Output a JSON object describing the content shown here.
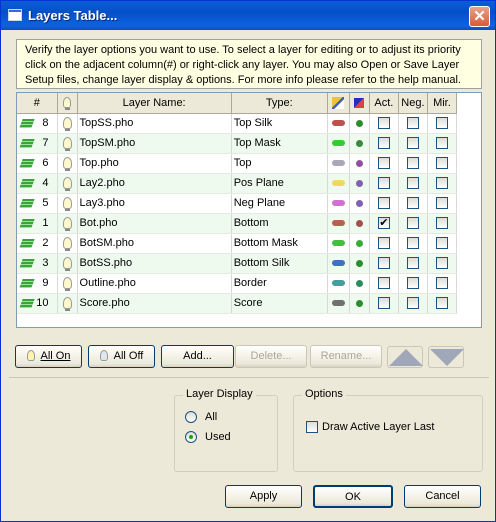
{
  "title": "Layers Table...",
  "info_text": "Verify the layer options you want to use. To select a layer for editing or to adjust its priority click on the adjacent column(#) or right-click any layer.  You may also Open or Save Layer Setup files, change layer display & options.  For more info please refer to the help manual.",
  "table": {
    "headers": {
      "num": "#",
      "name": "Layer Name:",
      "type": "Type:",
      "act": "Act.",
      "neg": "Neg.",
      "mir": "Mir."
    },
    "rows": [
      {
        "num": "8",
        "name": "TopSS.pho",
        "type": "Top Silk",
        "color": "#c0504d",
        "dot": "#2e8b2e",
        "act": false,
        "neg": false,
        "mir": false
      },
      {
        "num": "7",
        "name": "TopSM.pho",
        "type": "Top Mask",
        "color": "#33cc33",
        "dot": "#3a8a3a",
        "act": false,
        "neg": false,
        "mir": false
      },
      {
        "num": "6",
        "name": "Top.pho",
        "type": "Top",
        "color": "#a8a8b8",
        "dot": "#9050a0",
        "act": false,
        "neg": false,
        "mir": false
      },
      {
        "num": "4",
        "name": "Lay2.pho",
        "type": "Pos Plane",
        "color": "#f0d860",
        "dot": "#8060b0",
        "act": false,
        "neg": false,
        "mir": false
      },
      {
        "num": "5",
        "name": "Lay3.pho",
        "type": "Neg Plane",
        "color": "#d070d0",
        "dot": "#8060b0",
        "act": false,
        "neg": false,
        "mir": false
      },
      {
        "num": "1",
        "name": "Bot.pho",
        "type": "Bottom",
        "color": "#b86050",
        "dot": "#a05050",
        "act": true,
        "neg": false,
        "mir": false
      },
      {
        "num": "2",
        "name": "BotSM.pho",
        "type": "Bottom Mask",
        "color": "#40c040",
        "dot": "#3aaa3a",
        "act": false,
        "neg": false,
        "mir": false
      },
      {
        "num": "3",
        "name": "BotSS.pho",
        "type": "Bottom Silk",
        "color": "#4070c0",
        "dot": "#2e8b2e",
        "act": false,
        "neg": false,
        "mir": false
      },
      {
        "num": "9",
        "name": "Outline.pho",
        "type": "Border",
        "color": "#40a0a0",
        "dot": "#2e8b5e",
        "act": false,
        "neg": false,
        "mir": false
      },
      {
        "num": "10",
        "name": "Score.pho",
        "type": "Score",
        "color": "#707070",
        "dot": "#2e8b2e",
        "act": false,
        "neg": false,
        "mir": false
      }
    ]
  },
  "buttons": {
    "all_on": "All On",
    "all_off": "All Off",
    "add": "Add...",
    "delete": "Delete...",
    "rename": "Rename...",
    "apply": "Apply",
    "ok": "OK",
    "cancel": "Cancel"
  },
  "layer_display": {
    "title": "Layer Display",
    "options": [
      "All",
      "Used"
    ],
    "selected": "Used"
  },
  "options": {
    "title": "Options",
    "draw_active_last": "Draw Active Layer Last",
    "draw_active_last_checked": false
  }
}
